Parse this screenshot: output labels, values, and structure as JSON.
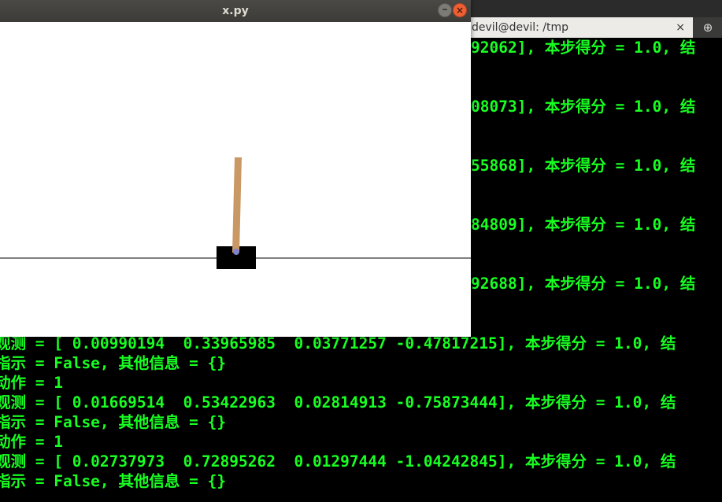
{
  "gym_window": {
    "title": "x.py"
  },
  "terminal": {
    "tab_title": "devil@devil: /tmp",
    "tab_close_glyph": "×",
    "new_tab_glyph": "⊕",
    "lines": [
      "92062], 本步得分 = 1.0, 结",
      "08073], 本步得分 = 1.0, 结",
      "55868], 本步得分 = 1.0, 结",
      "84809], 本步得分 = 1.0, 结",
      "92688], 本步得分 = 1.0, 结",
      "观测 = [ 0.00990194  0.33965985  0.03771257 -0.47817215], 本步得分 = 1.0, 结",
      "指示 = False, 其他信息 = {}",
      "动作 = 1",
      "观测 = [ 0.01669514  0.53422963  0.02814913 -0.75873444], 本步得分 = 1.0, 结",
      "指示 = False, 其他信息 = {}",
      "动作 = 1",
      "观测 = [ 0.02737973  0.72895262  0.01297444 -1.04242845], 本步得分 = 1.0, 结",
      "指示 = False, 其他信息 = {}"
    ]
  },
  "colors": {
    "terminal_text": "#18ff22",
    "pole": "#ca9865",
    "cart": "#000000",
    "axle": "#8181cb"
  }
}
